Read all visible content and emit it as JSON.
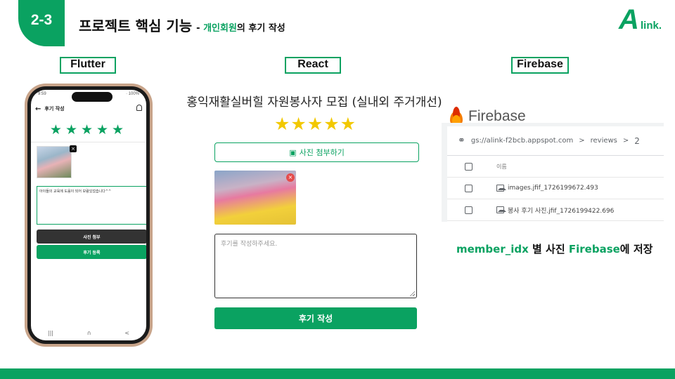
{
  "header": {
    "badge": "2-3",
    "title": "프로젝트 핵심 기능",
    "subtitle_dash": "- ",
    "subtitle_green": "개인회원",
    "subtitle_rest": "의 후기 작성",
    "logo_big": "A",
    "logo_small": "link."
  },
  "sections": {
    "flutter": "Flutter",
    "react": "React",
    "firebase": "Firebase"
  },
  "flutter_app": {
    "status_time": "9:59",
    "status_right": "· 100%",
    "back_icon": "←",
    "title": "후기 작성",
    "stars": "★★★★★",
    "photo_close": "×",
    "review_text": "아이들의 교육에 도움이 되어 보람있었습니다^^",
    "attach_label": "사진 첨부",
    "submit_label": "후기 등록",
    "nav_recent": "|||",
    "nav_home": "∩",
    "nav_back": "<"
  },
  "react_app": {
    "post_title": "홍익재활실버힐 자원봉사자 모집 (실내외 주거개선)",
    "stars": "★★★★★",
    "attach_icon": "▣",
    "attach_label": "사진 첨부하기",
    "photo_close": "×",
    "review_placeholder": "후기를 작성하주세요.",
    "submit_label": "후기 작성"
  },
  "firebase": {
    "brand": "Firebase",
    "link_icon": "⚭",
    "bucket_path": "gs://alink-f2bcb.appspot.com",
    "chevron": ">",
    "folder": "reviews",
    "subfolder": "2",
    "header_col": "이름",
    "files": [
      "images.jfif_1726199672.493",
      "봉사 후기 사진.jfif_1726199422.696"
    ],
    "caption_green1": "member_idx",
    "caption_mid": " 별 사진 ",
    "caption_green2": "Firebase",
    "caption_end": "에 저장"
  },
  "colors": {
    "accent": "#0aa261",
    "star_yellow": "#f2c800",
    "dark_button": "#333333"
  }
}
